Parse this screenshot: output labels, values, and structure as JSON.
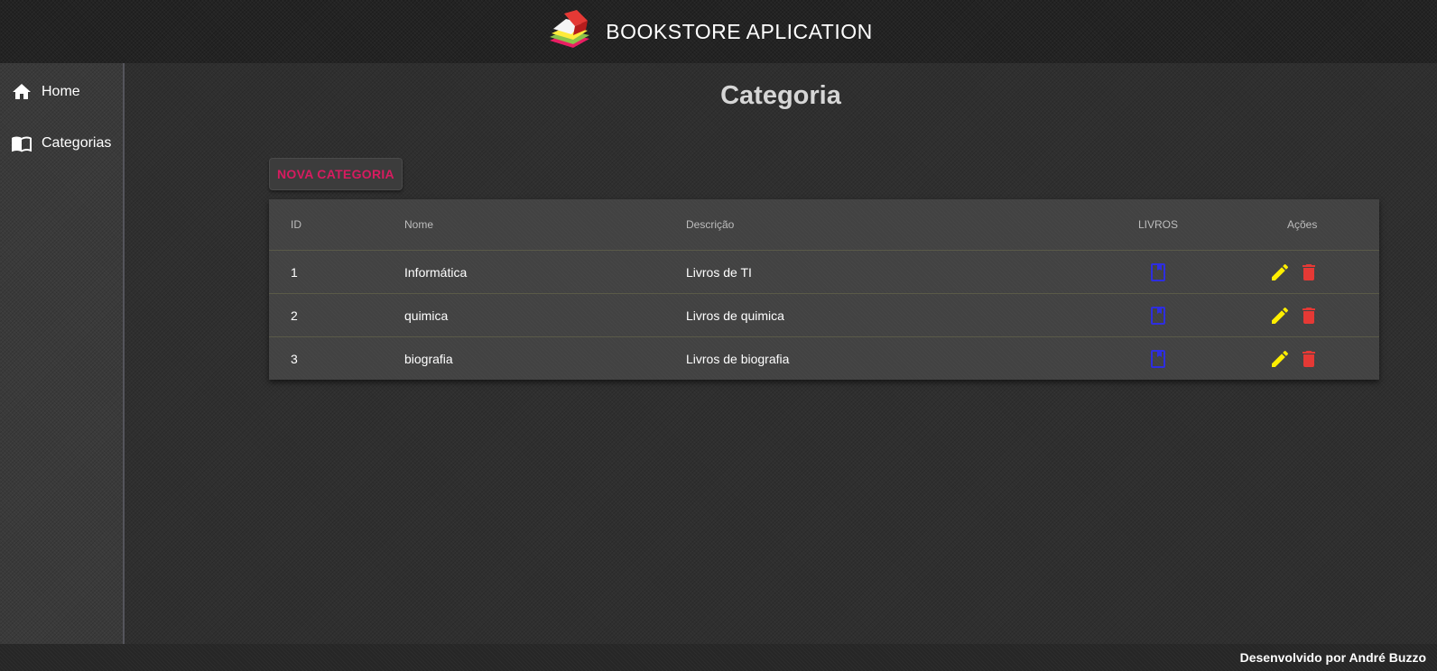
{
  "header": {
    "title": "BOOKSTORE APLICATION",
    "logo_icon": "books-stack-icon"
  },
  "sidebar": {
    "items": [
      {
        "label": "Home",
        "icon": "home-icon"
      },
      {
        "label": "Categorias",
        "icon": "book-open-icon"
      }
    ]
  },
  "main": {
    "title": "Categoria",
    "new_button_label": "NOVA CATEGORIA",
    "table": {
      "headers": {
        "id": "ID",
        "nome": "Nome",
        "descricao": "Descrição",
        "livros": "LIVROS",
        "acoes": "Ações"
      },
      "rows": [
        {
          "id": "1",
          "nome": "Informática",
          "descricao": "Livros de TI"
        },
        {
          "id": "2",
          "nome": "quimica",
          "descricao": "Livros de quimica"
        },
        {
          "id": "3",
          "nome": "biografia",
          "descricao": "Livros de biografia"
        }
      ]
    }
  },
  "footer": {
    "text": "Desenvolvido por André Buzzo"
  },
  "colors": {
    "accent": "#d81b60",
    "livros_icon": "#2e2ee0",
    "edit_icon": "#ffee00",
    "delete_icon": "#e53935"
  }
}
